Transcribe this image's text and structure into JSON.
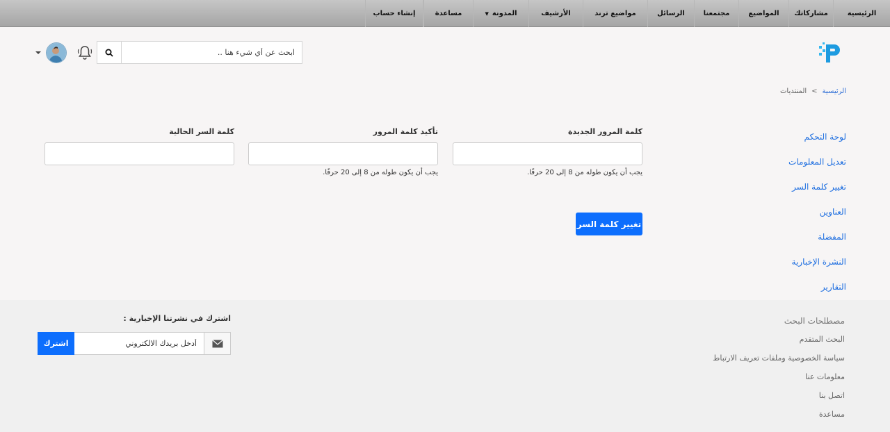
{
  "topnav": {
    "items": [
      {
        "label": "الرئيسية"
      },
      {
        "label": "مشاركاتك"
      },
      {
        "label": "المواضيع"
      },
      {
        "label": "مجتمعنا"
      },
      {
        "label": "الرسائل"
      },
      {
        "label": "مواضيع ترند"
      },
      {
        "label": "الأرشيف"
      },
      {
        "label": "المدونة",
        "dropdown": true
      },
      {
        "label": "مساعدة"
      },
      {
        "label": "إنشاء حساب"
      }
    ]
  },
  "header": {
    "search_placeholder": "ابحث عن أي شيء هنا ..",
    "icons": {
      "search": "search-icon",
      "bell": "bell-icon",
      "avatar": "avatar",
      "caret": "caret-down-icon",
      "logo": "site-logo"
    },
    "colors": {
      "logo": "#1e9be0",
      "logo_accent": "#35b8f0"
    }
  },
  "breadcrumb": {
    "home": "الرئيسية",
    "separator": ">",
    "current": "المنتديات"
  },
  "sidebar": {
    "items": [
      {
        "label": "لوحة التحكم"
      },
      {
        "label": "تعديل المعلومات"
      },
      {
        "label": "تغيير كلمة السر"
      },
      {
        "label": "العناوين"
      },
      {
        "label": "المفضلة"
      },
      {
        "label": "النشرة الإخبارية"
      },
      {
        "label": "التقارير"
      }
    ]
  },
  "form": {
    "new_password": {
      "label": "كلمة المرور الجديدة",
      "value": "",
      "hint": "يجب أن يكون طوله من 8 إلى 20 حرفًا."
    },
    "confirm_password": {
      "label": "تأكيد كلمة المرور",
      "value": "",
      "hint": "يجب أن يكون طوله من 8 إلى 20 حرفًا."
    },
    "current_password": {
      "label": "كلمة السر الحالية",
      "value": ""
    },
    "submit_label": "تغيير كلمة السر",
    "accent_color": "#0d6efd"
  },
  "footer": {
    "links": [
      {
        "label": "مصطلحات البحث"
      },
      {
        "label": "البحث المتقدم"
      },
      {
        "label": "سياسة الخصوصية وملفات تعريف الارتباط"
      },
      {
        "label": "معلومات عنا"
      },
      {
        "label": "اتصل بنا"
      },
      {
        "label": "مساعدة"
      }
    ],
    "newsletter": {
      "title": "اشترك في نشرتنا الإخبارية :",
      "placeholder": "أدخل بريدك الالكتروني",
      "button_label": "اشترك",
      "icon": "envelope-icon"
    }
  }
}
